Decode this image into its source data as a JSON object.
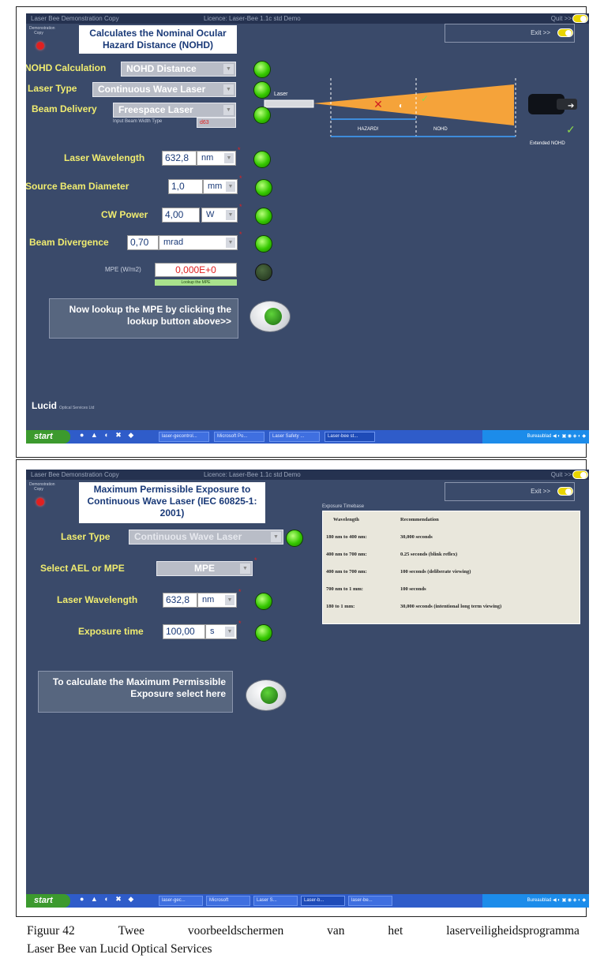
{
  "screen1": {
    "titlebar": {
      "app": "Laser Bee Demonstration Copy",
      "licence": "Licence: Laser-Bee 1.1c std Demo",
      "quit_label": "Quit >>"
    },
    "demo_label": "Demonstration Copy",
    "title": "Calculates the Nominal Ocular Hazard Distance (NOHD)",
    "exit_label": "Exit >>",
    "fields": {
      "nohd_calc_label": "NOHD Calculation",
      "nohd_calc_value": "NOHD Distance",
      "laser_type_label": "Laser Type",
      "laser_type_value": "Continuous Wave Laser",
      "beam_delivery_label": "Beam Delivery",
      "beam_delivery_value": "Freespace Laser",
      "beam_width_type_label": "Input Beam Width Type",
      "beam_width_type_value": "d63",
      "wavelength_label": "Laser Wavelength",
      "wavelength_value": "632,8",
      "wavelength_unit": "nm",
      "source_diam_label": "Source Beam Diameter",
      "source_diam_value": "1,0",
      "source_diam_unit": "mm",
      "cw_power_label": "CW Power",
      "cw_power_value": "4,00",
      "cw_power_unit": "W",
      "divergence_label": "Beam Divergence",
      "divergence_value": "0,70",
      "divergence_unit": "mrad",
      "mpe_label": "MPE (W/m2)",
      "mpe_value": "0,000E+0",
      "lookup_label": "Lookup the MPE"
    },
    "hint": "Now lookup the MPE by clicking the lookup button above>>",
    "diagram": {
      "laser": "Laser",
      "hazard": "HAZARD!",
      "nohd": "NOHD",
      "extended": "Extended NOHD"
    },
    "footer_brand": "Lucid",
    "footer_sub": "Optical Services Ltd",
    "taskbar": {
      "start": "start",
      "items": [
        "laser-gecontrol...",
        "Microsoft Po...",
        "Laser Safety ...",
        "Laser-bee st..."
      ],
      "tray": "Bureaublad"
    }
  },
  "screen2": {
    "titlebar": {
      "app": "Laser Bee Demonstration Copy",
      "licence": "Licence: Laser-Bee 1.1c std Demo",
      "quit_label": "Quit >>"
    },
    "demo_label": "Demonstration Copy",
    "title": "Maximum Permissible Exposure to Continuous Wave Laser (IEC 60825-1: 2001)",
    "exit_label": "Exit >>",
    "fields": {
      "laser_type_label": "Laser Type",
      "laser_type_value": "Continuous Wave Laser",
      "ael_mpe_label": "Select AEL or MPE",
      "ael_mpe_value": "MPE",
      "wavelength_label": "Laser Wavelength",
      "wavelength_value": "632,8",
      "wavelength_unit": "nm",
      "exposure_label": "Exposure time",
      "exposure_value": "100,00",
      "exposure_unit": "s"
    },
    "exposure_table": {
      "title": "Exposure Timebase",
      "headers": [
        "Wavelength",
        "Recommendation"
      ],
      "rows": [
        [
          "180 nm to 400 nm:",
          "30,000 seconds"
        ],
        [
          "400 nm to 700 nm:",
          "0.25 seconds  (blink reflex)"
        ],
        [
          "400 nm to 700 nm:",
          "100 seconds (deliberate viewing)"
        ],
        [
          "700 nm to 1 mm:",
          "100 seconds"
        ],
        [
          "180 to 1 mm:",
          "30,000 seconds  (intentional long term viewing)"
        ]
      ]
    },
    "hint": "To calculate the Maximum Permissible Exposure  select here",
    "taskbar": {
      "start": "start",
      "items": [
        "laser-gec...",
        "Microsoft",
        "Laser S...",
        "Laser-b...",
        "laser-be..."
      ],
      "tray": "Bureaublad"
    }
  },
  "caption": {
    "words": [
      "Figuur 42",
      "Twee",
      "voorbeeldschermen",
      "van",
      "het",
      "laserveiligheidsprogramma"
    ],
    "line2": "Laser Bee van Lucid Optical Services"
  },
  "colors": {
    "window_bg": "#3a4a6a",
    "label_yellow": "#f0ec70",
    "led_green": "#35c800",
    "taskbar_blue": "#2f5cc9",
    "beam_orange": "#f5a33a"
  }
}
